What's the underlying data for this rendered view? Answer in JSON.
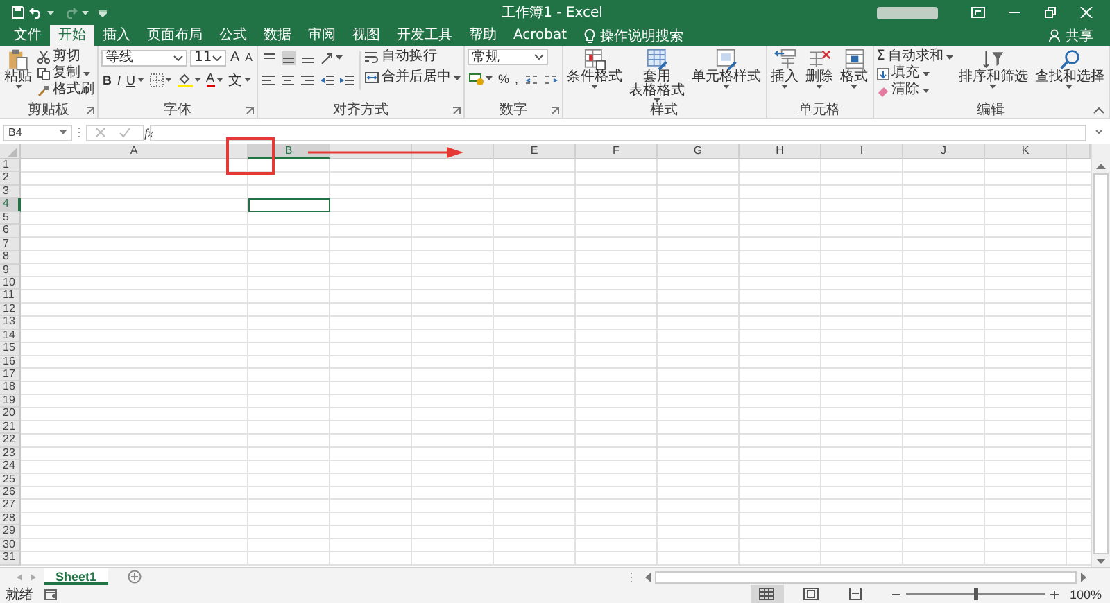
{
  "window": {
    "title": "工作簿1 - Excel"
  },
  "tabs": [
    {
      "label": "文件",
      "selected": false
    },
    {
      "label": "开始",
      "selected": true
    },
    {
      "label": "插入",
      "selected": false
    },
    {
      "label": "页面布局",
      "selected": false
    },
    {
      "label": "公式",
      "selected": false
    },
    {
      "label": "数据",
      "selected": false
    },
    {
      "label": "审阅",
      "selected": false
    },
    {
      "label": "视图",
      "selected": false
    },
    {
      "label": "开发工具",
      "selected": false
    },
    {
      "label": "帮助",
      "selected": false
    },
    {
      "label": "Acrobat",
      "selected": false
    }
  ],
  "tell_me": {
    "label": "操作说明搜索"
  },
  "share": {
    "label": "共享"
  },
  "ribbon": [
    {
      "kind": "clipboard",
      "title": "剪贴板",
      "paste": "粘贴",
      "cut": "剪切",
      "copy": "复制",
      "format_painter": "格式刷"
    },
    {
      "kind": "font",
      "title": "字体",
      "font_name": "等线",
      "font_size": "11",
      "size_buttons": [
        "A",
        "A"
      ],
      "style_buttons": [
        "B",
        "I",
        "U"
      ],
      "font_color": "A",
      "phonetic": "文"
    },
    {
      "kind": "alignment",
      "title": "对齐方式",
      "wrap_text": "自动换行",
      "merge_center": "合并后居中"
    },
    {
      "kind": "number",
      "title": "数字",
      "format": "常规",
      "percent": "%",
      "comma": ","
    },
    {
      "kind": "styles",
      "title": "样式",
      "buttons": [
        {
          "lines": [
            "条件格式"
          ]
        },
        {
          "lines": [
            "套用",
            "表格格式"
          ]
        },
        {
          "lines": [
            "单元格样式"
          ]
        }
      ]
    },
    {
      "kind": "cells",
      "title": "单元格",
      "buttons": [
        "插入",
        "删除",
        "格式"
      ]
    },
    {
      "kind": "editing",
      "title": "编辑",
      "sigma": "Σ",
      "autosum": "自动求和",
      "fill": "填充",
      "clear": "清除",
      "sort_filter": "排序和筛选",
      "find_select": "查找和选择"
    }
  ],
  "formula_bar": {
    "name_box": "B4",
    "fx": "fx"
  },
  "columns": [
    {
      "label": "A",
      "selected": false
    },
    {
      "label": "B",
      "selected": true
    },
    {
      "selected": false
    },
    {
      "selected": false
    },
    {
      "label": "E",
      "selected": false
    },
    {
      "label": "F",
      "selected": false
    },
    {
      "label": "G",
      "selected": false
    },
    {
      "label": "H",
      "selected": false
    },
    {
      "label": "I",
      "selected": false
    },
    {
      "label": "J",
      "selected": false
    },
    {
      "label": "K",
      "selected": false
    }
  ],
  "rows": [
    {
      "label": "1",
      "selected": false
    },
    {
      "label": "2",
      "selected": false
    },
    {
      "label": "3",
      "selected": false
    },
    {
      "label": "4",
      "selected": true
    },
    {
      "label": "5",
      "selected": false
    },
    {
      "label": "6",
      "selected": false
    },
    {
      "label": "7",
      "selected": false
    },
    {
      "label": "8",
      "selected": false
    },
    {
      "label": "9",
      "selected": false
    },
    {
      "label": "10",
      "selected": false
    },
    {
      "label": "11",
      "selected": false
    },
    {
      "label": "12",
      "selected": false
    },
    {
      "label": "13",
      "selected": false
    },
    {
      "label": "14",
      "selected": false
    },
    {
      "label": "15",
      "selected": false
    },
    {
      "label": "16",
      "selected": false
    },
    {
      "label": "17",
      "selected": false
    },
    {
      "label": "18",
      "selected": false
    },
    {
      "label": "19",
      "selected": false
    },
    {
      "label": "20",
      "selected": false
    },
    {
      "label": "21",
      "selected": false
    },
    {
      "label": "22",
      "selected": false
    },
    {
      "label": "23",
      "selected": false
    },
    {
      "label": "24",
      "selected": false
    },
    {
      "label": "25",
      "selected": false
    },
    {
      "label": "26",
      "selected": false
    },
    {
      "label": "27",
      "selected": false
    },
    {
      "label": "28",
      "selected": false
    },
    {
      "label": "29",
      "selected": false
    },
    {
      "label": "30",
      "selected": false
    },
    {
      "label": "31",
      "selected": false
    }
  ],
  "sheets": [
    {
      "label": "Sheet1",
      "selected": true
    }
  ],
  "status_bar": {
    "text": "就绪",
    "views": [
      {
        "kind": "normal",
        "selected": true
      },
      {
        "kind": "page_layout",
        "selected": false
      },
      {
        "kind": "page_break",
        "selected": false
      }
    ],
    "zoom": {
      "level": 0.5,
      "reading": "100%"
    }
  }
}
